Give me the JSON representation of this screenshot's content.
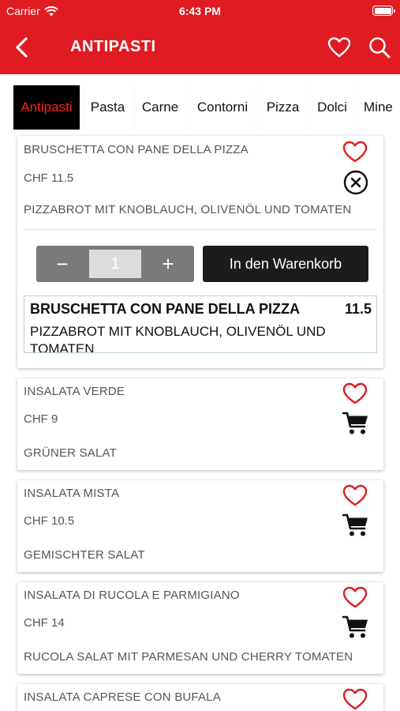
{
  "status_bar": {
    "carrier": "Carrier",
    "time": "6:43 PM"
  },
  "header": {
    "title": "ANTIPASTI"
  },
  "tabs": [
    {
      "label": "Antipasti",
      "active": true
    },
    {
      "label": "Pasta"
    },
    {
      "label": "Carne"
    },
    {
      "label": "Contorni"
    },
    {
      "label": "Pizza"
    },
    {
      "label": "Dolci"
    },
    {
      "label": "Mine"
    }
  ],
  "products": [
    {
      "name": "BRUSCHETTA CON PANE DELLA PIZZA",
      "price": "CHF 11.5",
      "description": "PIZZABROT MIT KNOBLAUCH, OLIVENÖL UND TOMATEN",
      "expanded": true,
      "quantity": "1",
      "stepper": {
        "minus": "−",
        "plus": "+"
      },
      "add_to_cart_label": "In den Warenkorb",
      "preview": {
        "title": "BRUSCHETTA CON PANE DELLA PIZZA",
        "price": "11.5",
        "description": "PIZZABROT MIT KNOBLAUCH, OLIVENÖL UND TOMATEN"
      }
    },
    {
      "name": "INSALATA VERDE",
      "price": "CHF 9",
      "description": "GRÜNER SALAT"
    },
    {
      "name": "INSALATA MISTA",
      "price": "CHF 10.5",
      "description": "GEMISCHTER SALAT"
    },
    {
      "name": "INSALATA DI RUCOLA E PARMIGIANO",
      "price": "CHF 14",
      "description": "RUCOLA SALAT MIT PARMESAN UND CHERRY TOMATEN"
    },
    {
      "name": "INSALATA CAPRESE CON BUFALA"
    }
  ],
  "colors": {
    "brand_red": "#e01b22",
    "active_tab_bg": "#000000",
    "active_tab_text": "#ff1f1f",
    "heart": "#e01b22"
  },
  "icons": {
    "back": "chevron-left-icon",
    "favorites": "heart-outline-icon",
    "search": "search-icon",
    "close": "close-circle-icon",
    "cart": "cart-icon"
  }
}
